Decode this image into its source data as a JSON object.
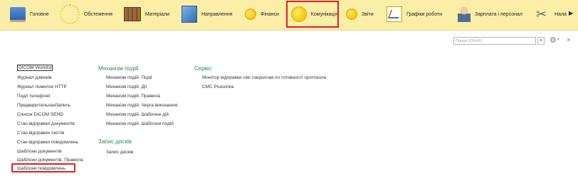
{
  "sections": [
    {
      "label": "Головне",
      "icon": "home-book-icon"
    },
    {
      "label": "Обстеження",
      "icon": "sun-icon"
    },
    {
      "label": "Матеріали",
      "icon": "crate-icon"
    },
    {
      "label": "Направлення",
      "icon": "building-icon"
    },
    {
      "label": "Фінанси",
      "icon": "coin-icon"
    },
    {
      "label": "Комунікація",
      "icon": "coin-icon"
    },
    {
      "label": "Звіти",
      "icon": "coin-icon"
    },
    {
      "label": "Графіки роботи",
      "icon": "chart-icon"
    },
    {
      "label": "Зарплата і персонал",
      "icon": "person-icon"
    },
    {
      "label": "Нала",
      "icon": "tools-icon"
    }
  ],
  "search": {
    "placeholder": "Пошук (Ctrl+F)",
    "clear": "×"
  },
  "toolbar": {
    "gear": "⚙",
    "dropdown": "▾",
    "close": "×"
  },
  "column1": [
    "DICOM Worklist",
    "Журнал дзвінків",
    "Журнал помилок HTTP",
    "Події телефонії",
    "ПредварительнаяЗапись",
    "Список DICOM SEND",
    "Стан відправки документів",
    "Стан відправки листів",
    "Стан відправки повідомлень",
    "Шаблони документів",
    "Шаблони документів. Правила",
    "Шаблони повідомлень"
  ],
  "column2": {
    "group1_title": "Механізм подій",
    "group1_items": [
      "Механізм подій. Події",
      "Механізм подій. Дії",
      "Механізм подій. Правила",
      "Механізм подій. Черга виконання",
      "Механізм подій. Шаблони дій",
      "Механізм подій. Шаблони подій"
    ],
    "group2_title": "Запис дисків",
    "group2_items": [
      "Запис дисків"
    ]
  },
  "column3": {
    "group_title": "Сервіс",
    "items": [
      "Монітор відправки смс пацієнтам по готовності протокола",
      "СМС Розсилка"
    ]
  },
  "colors": {
    "topbar": "#fbeea6",
    "highlight": "#e0202a",
    "group_title": "#2e8b57"
  }
}
